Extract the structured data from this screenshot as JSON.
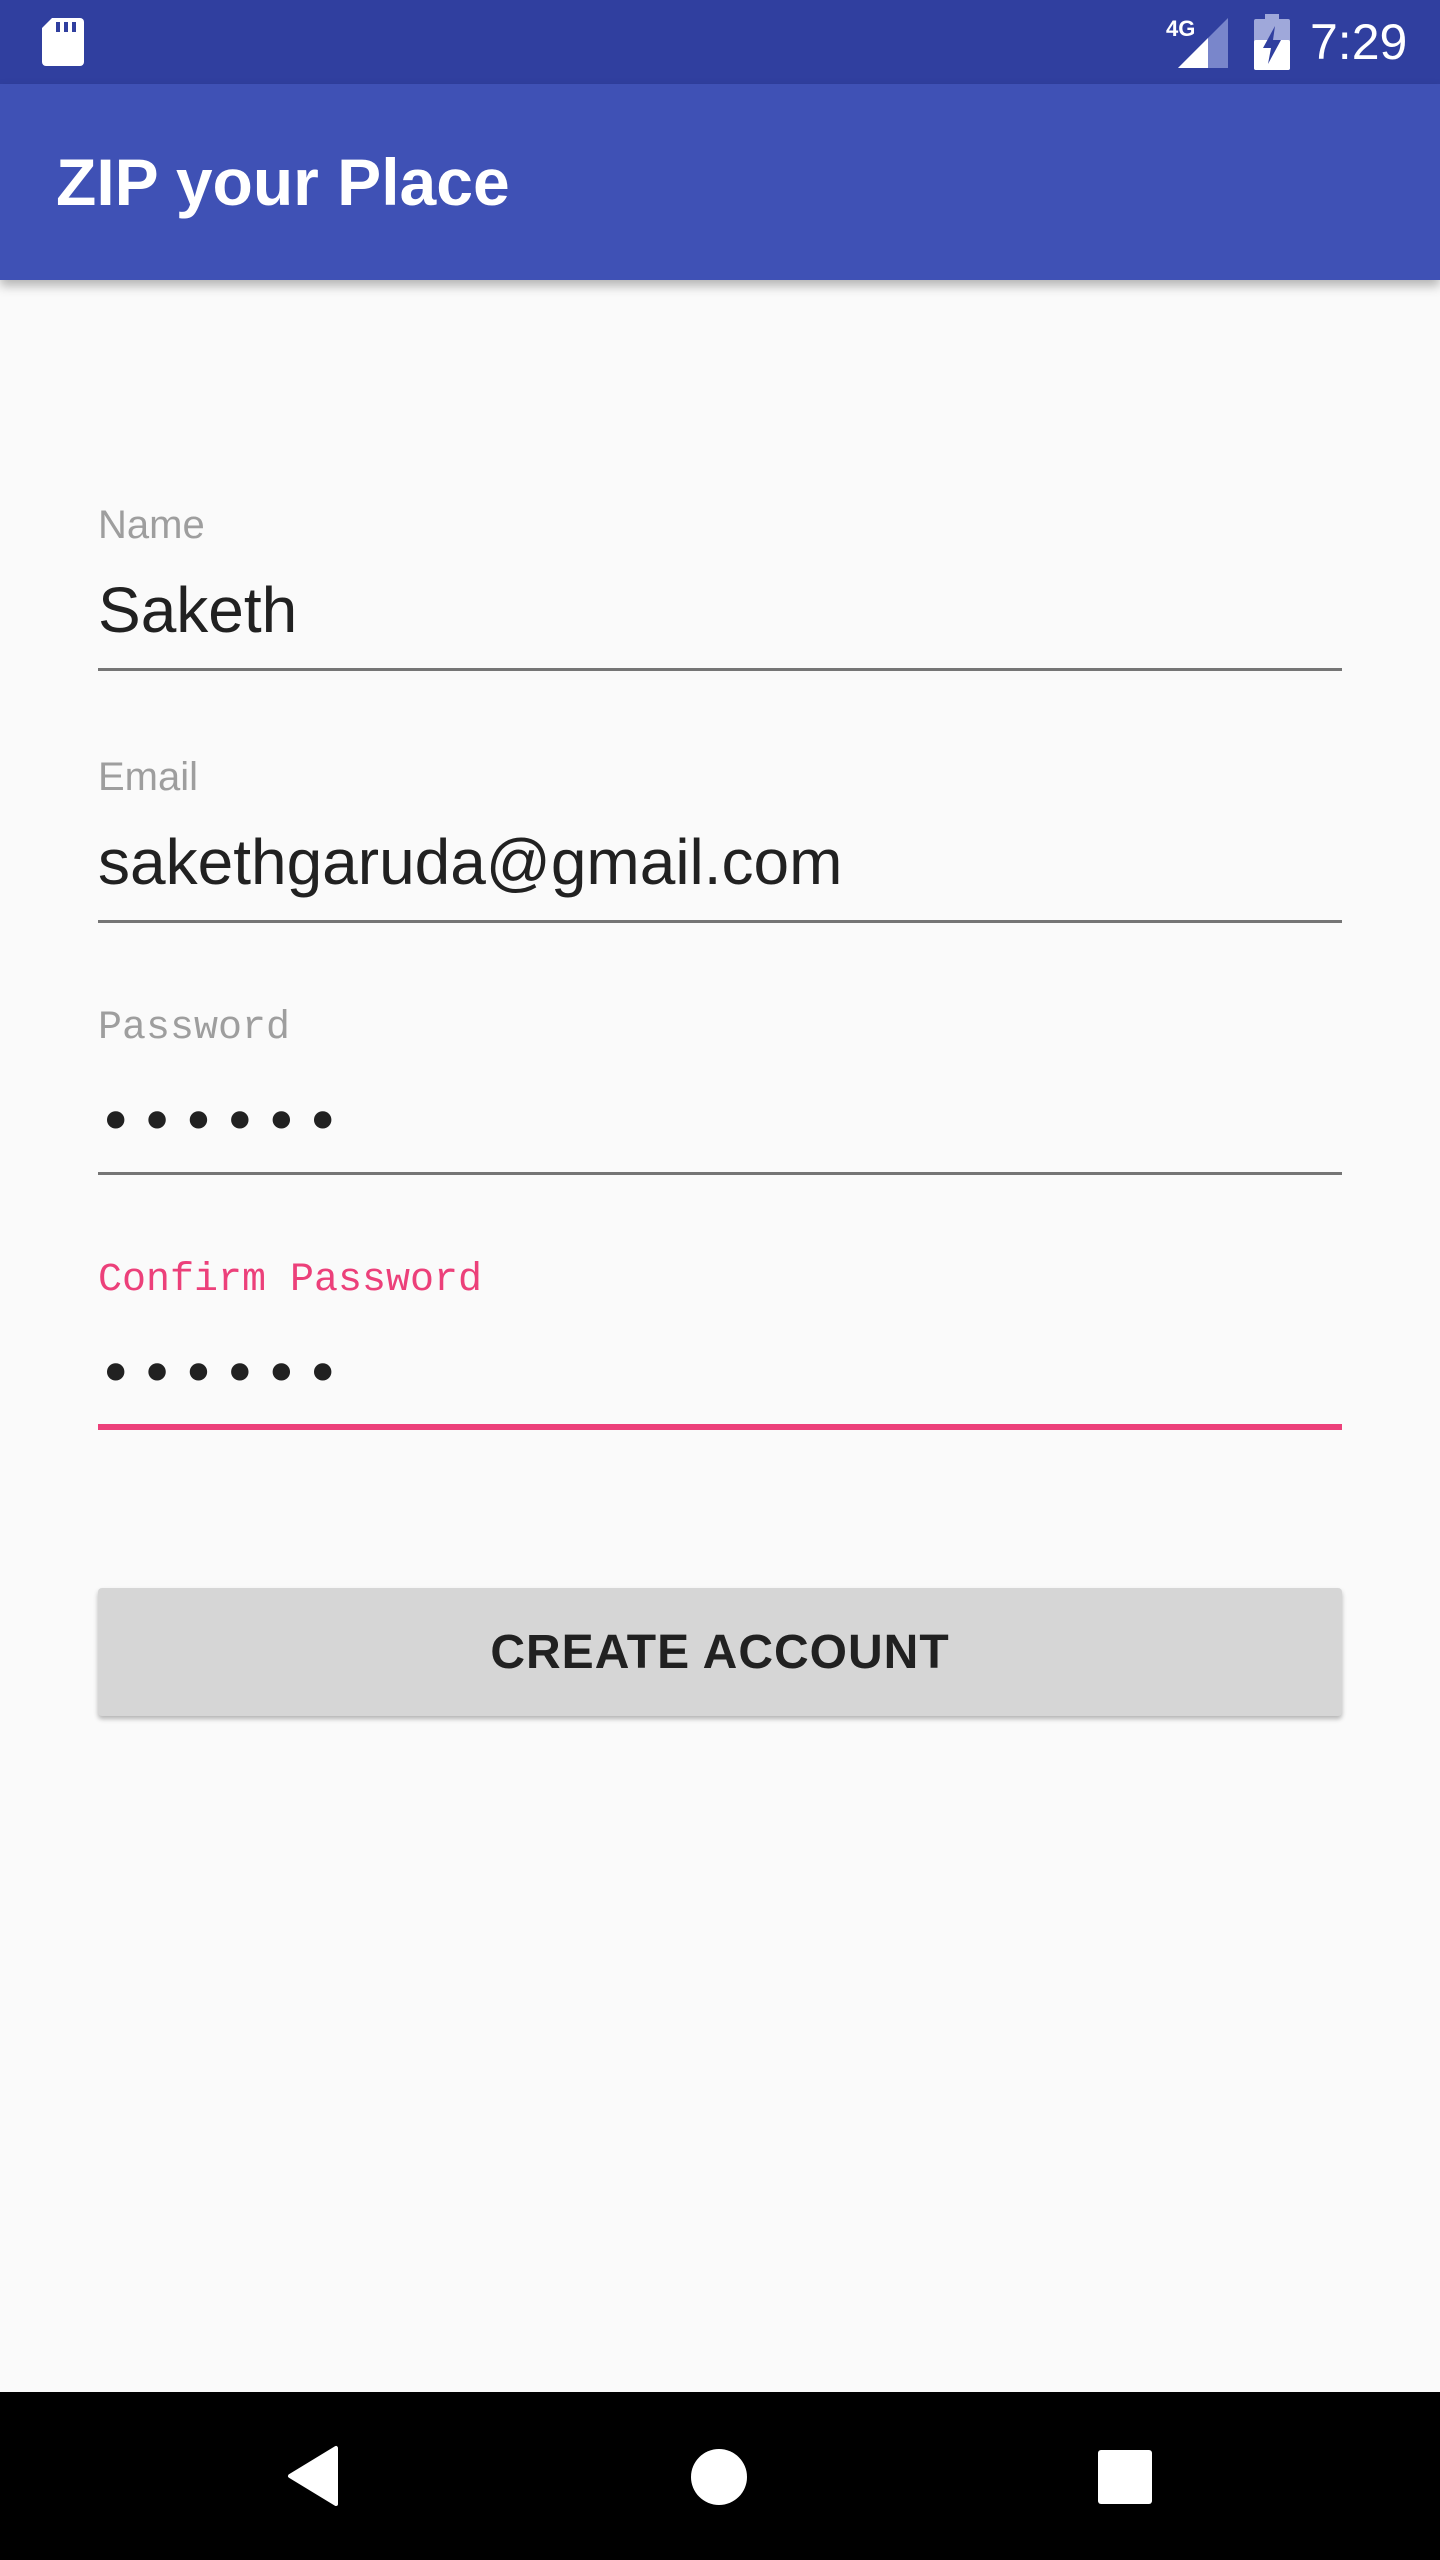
{
  "status_bar": {
    "network_type": "4G",
    "time": "7:29",
    "icons": [
      "sd-card-icon",
      "cellular-signal-icon",
      "battery-charging-icon"
    ]
  },
  "app_bar": {
    "title": "ZIP your Place"
  },
  "form": {
    "name": {
      "label": "Name",
      "value": "Saketh"
    },
    "email": {
      "label": "Email",
      "value": "sakethgaruda@gmail.com"
    },
    "password": {
      "label": "Password",
      "masked_value": "••••••"
    },
    "confirm_password": {
      "label": "Confirm Password",
      "masked_value": "••••••"
    }
  },
  "actions": {
    "create_account_label": "CREATE ACCOUNT"
  },
  "nav_bar": {
    "icons": [
      "back-icon",
      "home-icon",
      "recents-icon"
    ]
  },
  "colors": {
    "status_bar": "#303f9f",
    "primary": "#3f51b5",
    "accent": "#ec407a",
    "background": "#fafafa",
    "button": "#d6d6d6"
  }
}
